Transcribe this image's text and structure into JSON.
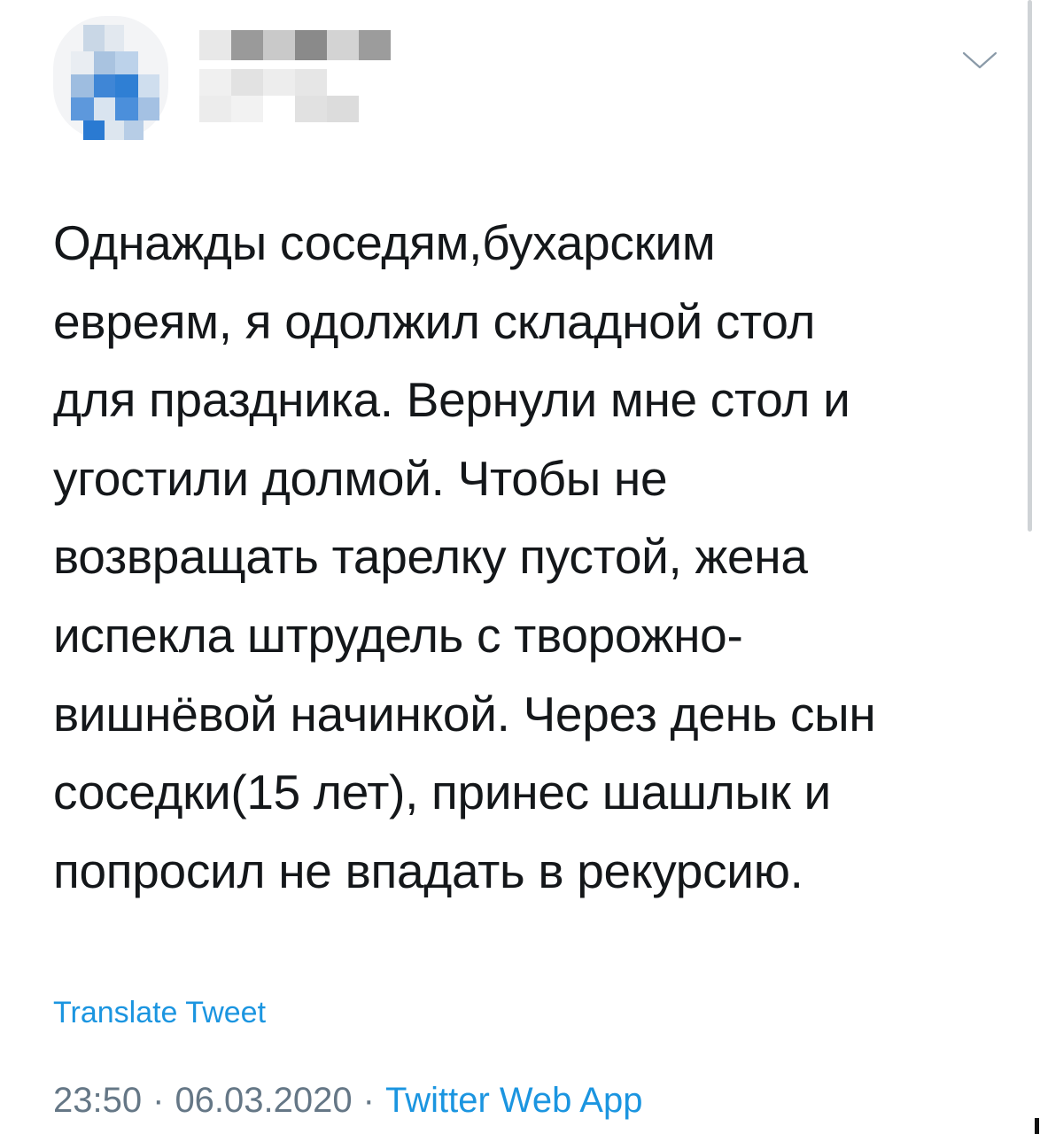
{
  "tweet": {
    "text_lines": [
      "Однажды соседям,бухарским",
      "евреям, я одолжил складной стол",
      "для праздника. Вернули мне стол и",
      "угостили долмой. Чтобы не",
      "возвращать тарелку пустой, жена",
      "испекла штрудель с творожно-",
      "вишнёвой начинкой. Через день сын",
      "соседки(15 лет), принес шашлык и",
      "попросил не впадать в рекурсию."
    ],
    "translate_label": "Translate Tweet",
    "time": "23:50",
    "date": "06.03.2020",
    "separator": "·",
    "client": "Twitter Web App"
  },
  "icons": {
    "menu": "chevron-down-icon",
    "avatar": "avatar-pixelated"
  },
  "colors": {
    "text": "#14171a",
    "link": "#1b95e0",
    "muted": "#657786",
    "background": "#ffffff"
  }
}
